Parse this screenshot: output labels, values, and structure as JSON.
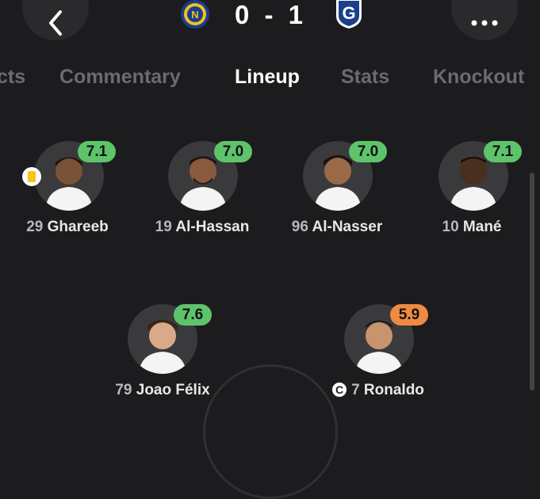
{
  "colors": {
    "background": "#1c1c1e",
    "rating_green": "#5dc46b",
    "rating_orange": "#ef8a42",
    "tab_inactive": "#6b6b70",
    "tab_active": "#ffffff"
  },
  "header": {
    "back_icon": "chevron-left-icon",
    "more_icon": "ellipsis-icon",
    "home_logo": "al-nassr-crest-icon",
    "away_logo": "gamba-osaka-crest-icon",
    "score_home": "0",
    "score_separator": "-",
    "score_away": "1"
  },
  "tabs": [
    {
      "label": "cts"
    },
    {
      "label": "Commentary"
    },
    {
      "label": "Lineup"
    },
    {
      "label": "Stats"
    },
    {
      "label": "Knockout"
    }
  ],
  "players": [
    {
      "number": "29",
      "name": "Ghareeb",
      "rating": "7.1",
      "rating_color": "#5dc46b",
      "yellow_card": true,
      "captain": false
    },
    {
      "number": "19",
      "name": "Al-Hassan",
      "rating": "7.0",
      "rating_color": "#5dc46b",
      "yellow_card": false,
      "captain": false
    },
    {
      "number": "96",
      "name": "Al-Nasser",
      "rating": "7.0",
      "rating_color": "#5dc46b",
      "yellow_card": false,
      "captain": false
    },
    {
      "number": "10",
      "name": "Mané",
      "rating": "7.1",
      "rating_color": "#5dc46b",
      "yellow_card": false,
      "captain": false
    },
    {
      "number": "79",
      "name": "Joao Félix",
      "rating": "7.6",
      "rating_color": "#5dc46b",
      "yellow_card": false,
      "captain": false
    },
    {
      "number": "7",
      "name": "Ronaldo",
      "rating": "5.9",
      "rating_color": "#ef8a42",
      "yellow_card": false,
      "captain": true
    }
  ],
  "captain_badge": "C"
}
